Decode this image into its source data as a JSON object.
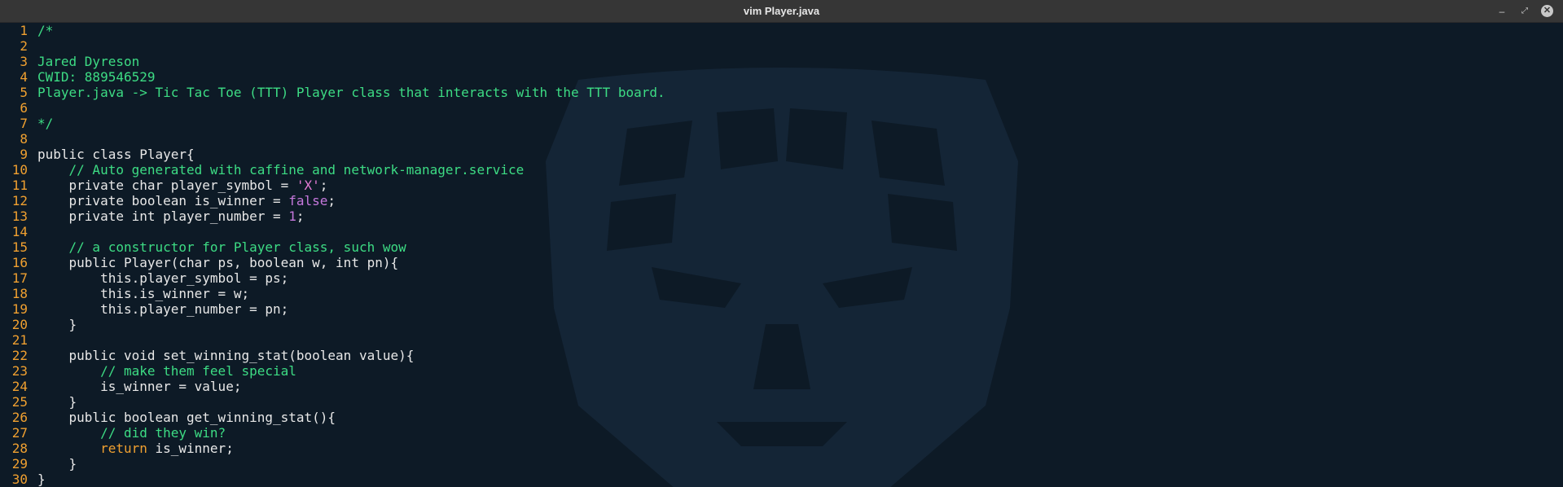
{
  "window": {
    "title": "vim Player.java",
    "controls": {
      "minimize": "–",
      "maximize": "⤢",
      "close": "✕"
    }
  },
  "colors": {
    "background": "#0d1a26",
    "line_number": "#f0a030",
    "comment": "#3ddc84",
    "text": "#d8e0e8",
    "literal": "#c678dd",
    "string": "#e57bd5",
    "return_keyword": "#f0a030"
  },
  "editor": {
    "lines": [
      {
        "n": "1",
        "segments": [
          {
            "t": "/*",
            "c": "comment"
          }
        ]
      },
      {
        "n": "2",
        "segments": []
      },
      {
        "n": "3",
        "segments": [
          {
            "t": "Jared Dyreson",
            "c": "comment"
          }
        ]
      },
      {
        "n": "4",
        "segments": [
          {
            "t": "CWID: 889546529",
            "c": "comment"
          }
        ]
      },
      {
        "n": "5",
        "segments": [
          {
            "t": "Player.java -> Tic Tac Toe (TTT) Player class that interacts with the TTT board.",
            "c": "comment"
          }
        ]
      },
      {
        "n": "6",
        "segments": []
      },
      {
        "n": "7",
        "segments": [
          {
            "t": "*/",
            "c": "comment"
          }
        ]
      },
      {
        "n": "8",
        "segments": []
      },
      {
        "n": "9",
        "segments": [
          {
            "t": "public class Player{",
            "c": "kw"
          }
        ]
      },
      {
        "n": "10",
        "segments": [
          {
            "t": "    // Auto generated with caffine and network-manager.service",
            "c": "comment"
          }
        ]
      },
      {
        "n": "11",
        "segments": [
          {
            "t": "    private char player_symbol = ",
            "c": "kw"
          },
          {
            "t": "'X'",
            "c": "str"
          },
          {
            "t": ";",
            "c": "kw"
          }
        ]
      },
      {
        "n": "12",
        "segments": [
          {
            "t": "    private boolean is_winner = ",
            "c": "kw"
          },
          {
            "t": "false",
            "c": "bool"
          },
          {
            "t": ";",
            "c": "kw"
          }
        ]
      },
      {
        "n": "13",
        "segments": [
          {
            "t": "    private int player_number = ",
            "c": "kw"
          },
          {
            "t": "1",
            "c": "num"
          },
          {
            "t": ";",
            "c": "kw"
          }
        ]
      },
      {
        "n": "14",
        "segments": []
      },
      {
        "n": "15",
        "segments": [
          {
            "t": "    // a constructor for Player class, such wow",
            "c": "comment"
          }
        ]
      },
      {
        "n": "16",
        "segments": [
          {
            "t": "    public Player(char ps, boolean w, int pn){",
            "c": "kw"
          }
        ]
      },
      {
        "n": "17",
        "segments": [
          {
            "t": "        this.player_symbol = ps;",
            "c": "kw"
          }
        ]
      },
      {
        "n": "18",
        "segments": [
          {
            "t": "        this.is_winner = w;",
            "c": "kw"
          }
        ]
      },
      {
        "n": "19",
        "segments": [
          {
            "t": "        this.player_number = pn;",
            "c": "kw"
          }
        ]
      },
      {
        "n": "20",
        "segments": [
          {
            "t": "    }",
            "c": "kw"
          }
        ]
      },
      {
        "n": "21",
        "segments": []
      },
      {
        "n": "22",
        "segments": [
          {
            "t": "    public void set_winning_stat(boolean value){",
            "c": "kw"
          }
        ]
      },
      {
        "n": "23",
        "segments": [
          {
            "t": "        // make them feel special",
            "c": "comment"
          }
        ]
      },
      {
        "n": "24",
        "segments": [
          {
            "t": "        is_winner = value;",
            "c": "kw"
          }
        ]
      },
      {
        "n": "25",
        "segments": [
          {
            "t": "    }",
            "c": "kw"
          }
        ]
      },
      {
        "n": "26",
        "segments": [
          {
            "t": "    public boolean get_winning_stat(){",
            "c": "kw"
          }
        ]
      },
      {
        "n": "27",
        "segments": [
          {
            "t": "        // did they win?",
            "c": "comment"
          }
        ]
      },
      {
        "n": "28",
        "segments": [
          {
            "t": "        ",
            "c": "kw"
          },
          {
            "t": "return",
            "c": "ret"
          },
          {
            "t": " is_winner;",
            "c": "kw"
          }
        ]
      },
      {
        "n": "29",
        "segments": [
          {
            "t": "    }",
            "c": "kw"
          }
        ]
      },
      {
        "n": "30",
        "segments": [
          {
            "t": "}",
            "c": "kw"
          }
        ]
      }
    ]
  }
}
